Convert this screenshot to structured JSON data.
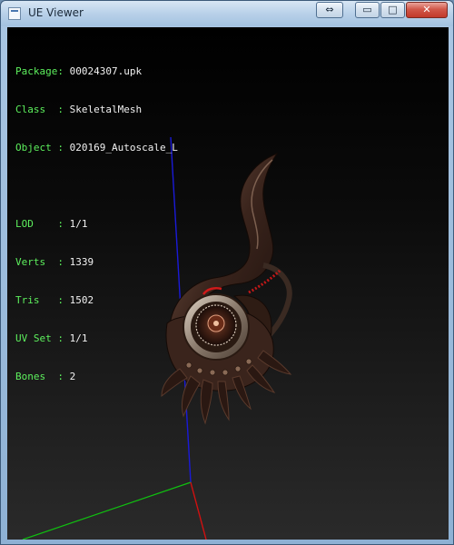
{
  "window": {
    "title": "UE Viewer",
    "icon": "app-icon",
    "controls": {
      "restore_glyph": "⇔",
      "minimize_glyph": "▭",
      "maximize_glyph": "□",
      "close_glyph": "✕"
    }
  },
  "info": {
    "object_fields": [
      {
        "key": "Package: ",
        "value": "00024307.upk"
      },
      {
        "key": "Class  : ",
        "value": "SkeletalMesh"
      },
      {
        "key": "Object : ",
        "value": "020169_Autoscale_L"
      }
    ],
    "mesh_fields": [
      {
        "key": "LOD    : ",
        "value": "1/1"
      },
      {
        "key": "Verts  : ",
        "value": "1339"
      },
      {
        "key": "Tris   : ",
        "value": "1502"
      },
      {
        "key": "UV Set : ",
        "value": "1/1"
      },
      {
        "key": "Bones  : ",
        "value": "2"
      }
    ]
  },
  "colors": {
    "label": "#5df05d",
    "value": "#f2f2f2",
    "axis_x": "#d11010",
    "axis_y": "#10c010",
    "axis_z": "#1a1ad8",
    "mesh_dark": "#2a1812",
    "mesh_mid": "#6b4a3a",
    "mesh_light": "#c8b9aa"
  }
}
